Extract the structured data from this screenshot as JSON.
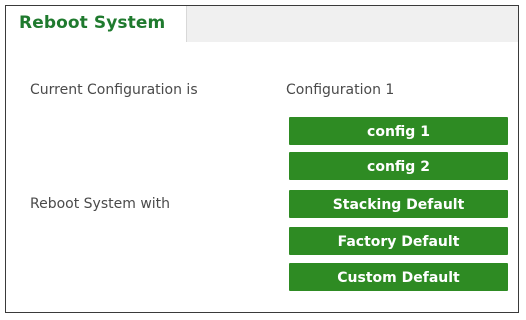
{
  "tab": {
    "title": "Reboot System"
  },
  "current_config": {
    "label": "Current Configuration is",
    "value": "Configuration 1"
  },
  "reboot_with": {
    "label": "Reboot System with",
    "buttons": [
      "config 1",
      "config 2",
      "Stacking Default",
      "Factory Default",
      "Custom Default"
    ]
  },
  "colors": {
    "title_green": "#1f7a2e",
    "button_green": "#2e8b23"
  }
}
